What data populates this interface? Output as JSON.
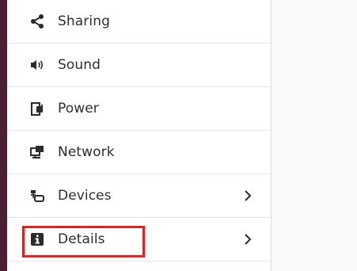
{
  "settings_sidebar": {
    "items": [
      {
        "label": "Sharing",
        "icon": "share-icon",
        "has_chevron": false
      },
      {
        "label": "Sound",
        "icon": "speaker-icon",
        "has_chevron": false
      },
      {
        "label": "Power",
        "icon": "power-plug-icon",
        "has_chevron": false
      },
      {
        "label": "Network",
        "icon": "network-icon",
        "has_chevron": false
      },
      {
        "label": "Devices",
        "icon": "devices-icon",
        "has_chevron": true
      },
      {
        "label": "Details",
        "icon": "info-icon",
        "has_chevron": true,
        "highlighted": true
      }
    ]
  },
  "colors": {
    "dock": "#4a1f34",
    "highlight": "#d9252a",
    "content_background": "#fafafa"
  }
}
